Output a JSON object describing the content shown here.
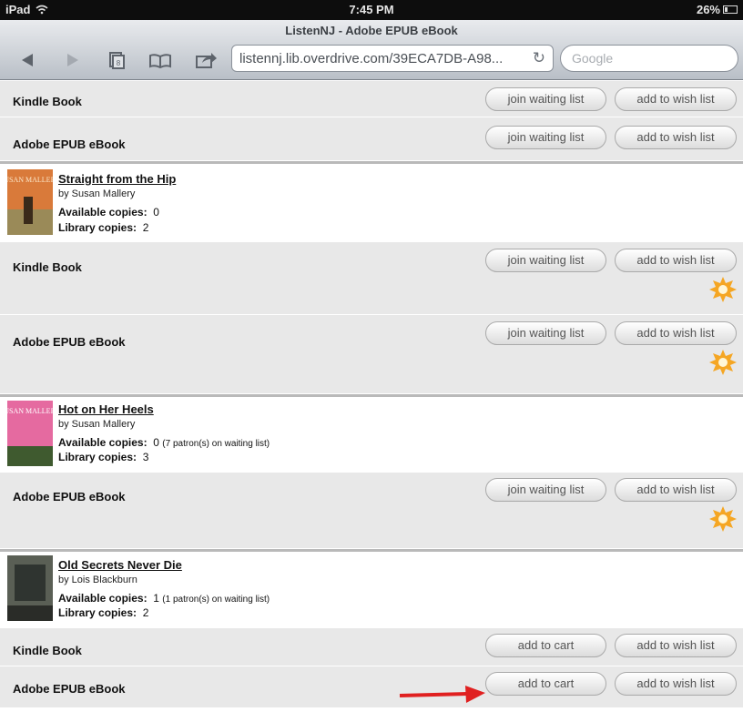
{
  "status_bar": {
    "device": "iPad",
    "wifi_icon": "wifi-icon",
    "time": "7:45 PM",
    "battery": "26%"
  },
  "browser": {
    "page_title": "ListenNJ - Adobe EPUB eBook",
    "url": "listennj.lib.overdrive.com/39ECA7DB-A98...",
    "search_placeholder": "Google",
    "icons": [
      "back-icon",
      "forward-icon",
      "tabs-icon",
      "bookmarks-icon",
      "share-icon",
      "reload-icon"
    ],
    "tab_count": "8"
  },
  "labels": {
    "join_waiting_list": "join waiting list",
    "add_to_wish_list": "add to wish list",
    "add_to_cart": "add to cart",
    "available_copies": "Available copies:",
    "library_copies": "Library copies:"
  },
  "top_formats": [
    {
      "name": "Kindle Book"
    },
    {
      "name": "Adobe EPUB eBook"
    }
  ],
  "books": [
    {
      "title": "Straight from the Hip",
      "author": "by Susan Mallery",
      "available": "0",
      "available_note": "",
      "library": "2",
      "cover_text": "SUSAN MALLERY",
      "formats": [
        {
          "name": "Kindle Book"
        },
        {
          "name": "Adobe EPUB eBook"
        }
      ]
    },
    {
      "title": "Hot on Her Heels",
      "author": "by Susan Mallery",
      "available": "0",
      "available_note": "(7 patron(s) on waiting list)",
      "library": "3",
      "cover_text": "SUSAN MALLERY",
      "formats": [
        {
          "name": "Adobe EPUB eBook"
        }
      ]
    },
    {
      "title": "Old Secrets Never Die",
      "author": "by Lois Blackburn",
      "available": "1",
      "available_note": "(1 patron(s) on waiting list)",
      "library": "2",
      "cover_text": "",
      "formats": [
        {
          "name": "Kindle Book"
        },
        {
          "name": "Adobe EPUB eBook"
        }
      ]
    }
  ],
  "colors": {
    "accent_arrow": "#e02020",
    "badge": "#f5a623",
    "row_bg": "#e8e8e8"
  }
}
